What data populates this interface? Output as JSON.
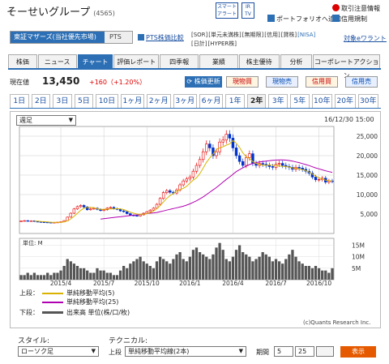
{
  "header": {
    "company_name": "そーせいグループ",
    "code": "(4565)",
    "smart_alert": "スマート\nアラート",
    "irtv": "IR\nTV",
    "links": [
      {
        "label": "ポートフォリオへ追加",
        "icon": "portfolio-icon"
      },
      {
        "label": "取引注意情報",
        "icon": "warning-icon"
      },
      {
        "label": "信用規制",
        "icon": "info-icon"
      }
    ]
  },
  "market": {
    "primary": "東証マザーズ(当社優先市場)",
    "secondary": "PTS",
    "pts_link": "PTS株価比較"
  },
  "badges": [
    "[SOR]",
    "[単元未満株]",
    "[無期限]",
    "[信用]",
    "[貸株]",
    "[NISA]",
    "[日計]",
    "[HYPER株]"
  ],
  "target_watch": "対象eワラント",
  "nav_tabs": [
    "株価",
    "ニュース",
    "チャート",
    "評価レポート",
    "四季報",
    "業績",
    "株主優待",
    "分析",
    "コーポレートアクション"
  ],
  "active_tab": 2,
  "price": {
    "label": "現在値",
    "value": "13,450",
    "change": "+160（+1.20%）"
  },
  "actions": {
    "update": "株価更新",
    "spot_buy": "現物買",
    "spot_sell": "現物売",
    "margin_buy": "信用買",
    "margin_sell": "信用売"
  },
  "periods": [
    "1日",
    "2日",
    "3日",
    "5日",
    "10日",
    "1ヶ月",
    "2ヶ月",
    "3ヶ月",
    "6ヶ月",
    "1年",
    "2年",
    "3年",
    "5年",
    "10年",
    "20年",
    "30年"
  ],
  "active_period": 10,
  "chart_controls": {
    "bar_type": "週足",
    "datetime": "16/12/30 15:00"
  },
  "legend": {
    "upper_label": "上段：",
    "ma5": "単純移動平均(5)",
    "ma25": "単純移動平均(25)",
    "lower_label": "下段：",
    "volume": "出来高 単位(株/口/枚)"
  },
  "copyright": "(c)Quants Research Inc.",
  "footer": {
    "style_label": "スタイル:",
    "style_value": "ローソク足",
    "tech_label": "テクニカル:",
    "upper_label": "上段",
    "tech_value": "単純移動平均線(2本)",
    "period_label": "期間",
    "period1": "5",
    "period2": "25",
    "show_button": "表示"
  },
  "colors": {
    "accent": "#2c6fb5",
    "up": "#e60000",
    "down": "#0033cc",
    "ma5": "#d9b300",
    "ma25": "#b000b0",
    "volume": "#555555",
    "show_button": "#e55a00"
  },
  "chart_data": [
    {
      "type": "candlestick",
      "title": "",
      "ylim": [
        0,
        27500
      ],
      "y_ticks": [
        5000,
        10000,
        15000,
        20000,
        25000
      ],
      "y_tick_labels": [
        "5,000",
        "10,000",
        "15,000",
        "20,000",
        "25,000"
      ],
      "x_ticks": [
        "2015/4",
        "2015/7",
        "2015/10",
        "2016/1",
        "2016/4",
        "2016/7",
        "2016/10"
      ],
      "x_tick_week_index": [
        12,
        25,
        38,
        51,
        64,
        77,
        90
      ],
      "close": [
        3200,
        3300,
        3150,
        3250,
        3100,
        3000,
        2950,
        2900,
        2850,
        2800,
        2850,
        2900,
        3000,
        3300,
        4200,
        5200,
        6300,
        6900,
        7200,
        6800,
        6100,
        6300,
        6500,
        6200,
        5900,
        6100,
        6500,
        6700,
        6400,
        6200,
        5800,
        5600,
        5100,
        4700,
        4600,
        4500,
        4800,
        5200,
        5600,
        6000,
        6500,
        7500,
        9000,
        10500,
        11000,
        10600,
        10400,
        11200,
        12500,
        13500,
        14000,
        14500,
        16000,
        17500,
        19000,
        21000,
        23000,
        22000,
        20000,
        21000,
        23500,
        24000,
        25500,
        24500,
        22000,
        20000,
        18500,
        17500,
        19500,
        20500,
        18000,
        17500,
        18000,
        17800,
        17500,
        17200,
        17000,
        17800,
        18000,
        17500,
        17200,
        17000,
        16500,
        17000,
        16800,
        16500,
        16000,
        15500,
        14500,
        13800,
        13900,
        14200,
        13200,
        13500,
        13450
      ],
      "ma5": [
        null,
        null,
        null,
        null,
        3200,
        3160,
        3090,
        3040,
        2980,
        2900,
        2880,
        2860,
        2880,
        2970,
        3250,
        3740,
        4400,
        5180,
        5960,
        6480,
        6660,
        6700,
        6580,
        6380,
        6200,
        6200,
        6240,
        6300,
        6340,
        6380,
        6320,
        6140,
        5820,
        5480,
        5200,
        5000,
        4940,
        4960,
        5100,
        5360,
        5780,
        6380,
        7160,
        8100,
        9000,
        9720,
        10280,
        10860,
        11280,
        11600,
        12120,
        12940,
        13700,
        14300,
        15400,
        16800,
        18300,
        19400,
        20400,
        21600,
        22000,
        22300,
        22700,
        23000,
        23900,
        23200,
        22100,
        20700,
        19700,
        19300,
        18500,
        18000,
        17800,
        17500,
        17560,
        17600,
        17520,
        17460,
        17380,
        17260,
        17220,
        17040,
        16860,
        16700,
        16560,
        16400,
        16160,
        15780,
        15300,
        14720,
        14320,
        14000,
        13700,
        13560,
        13450
      ],
      "ma25": [
        null,
        null,
        null,
        null,
        null,
        null,
        null,
        null,
        null,
        null,
        null,
        null,
        null,
        null,
        null,
        null,
        null,
        null,
        null,
        null,
        null,
        null,
        null,
        null,
        3700,
        3800,
        3900,
        4000,
        4100,
        4200,
        4300,
        4400,
        4500,
        4600,
        4700,
        4800,
        4900,
        5000,
        5100,
        5200,
        5300,
        5400,
        5600,
        5800,
        6000,
        6200,
        6400,
        6600,
        6800,
        7000,
        7300,
        7600,
        8000,
        8400,
        8900,
        9400,
        10000,
        10600,
        11200,
        11800,
        12500,
        13200,
        13900,
        14500,
        15200,
        15900,
        16400,
        16900,
        17300,
        17700,
        18000,
        18200,
        18400,
        18500,
        18600,
        18700,
        18800,
        18850,
        18900,
        18900,
        18850,
        18750,
        18600,
        18400,
        18200,
        17950,
        17700,
        17450,
        17150,
        16850,
        16600,
        16350,
        16100,
        15900,
        15700
      ]
    },
    {
      "type": "bar",
      "title": "",
      "unit_label": "単位: M",
      "ylim": [
        0,
        18
      ],
      "y_ticks": [
        5,
        10,
        15
      ],
      "y_tick_labels": [
        "5M",
        "10M",
        "15M"
      ],
      "values": [
        2,
        2,
        3,
        2,
        3,
        2,
        2,
        2,
        3,
        2,
        3,
        3,
        4,
        6,
        9,
        8,
        7,
        6,
        5,
        5,
        4,
        3,
        3,
        5,
        4,
        4,
        3,
        3,
        2,
        2,
        4,
        6,
        5,
        7,
        8,
        9,
        10,
        8,
        7,
        6,
        5,
        8,
        10,
        9,
        8,
        7,
        9,
        11,
        12,
        9,
        8,
        10,
        13,
        14,
        12,
        11,
        10,
        9,
        11,
        14,
        16,
        13,
        9,
        8,
        10,
        13,
        15,
        12,
        11,
        10,
        8,
        9,
        10,
        12,
        11,
        10,
        8,
        9,
        8,
        7,
        9,
        11,
        13,
        10,
        8,
        7,
        6,
        6,
        5,
        6,
        5,
        4,
        4,
        3,
        5
      ]
    }
  ]
}
